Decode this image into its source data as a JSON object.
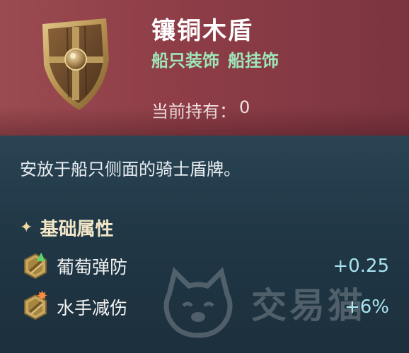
{
  "item": {
    "name": "镶铜木盾",
    "tags": [
      "船只装饰",
      "船挂饰"
    ],
    "owned_label": "当前持有：",
    "owned_count": "0",
    "description": "安放于船只侧面的骑士盾牌。"
  },
  "attributes": {
    "title": "基础属性",
    "stats": [
      {
        "name": "葡萄弹防",
        "value": "+0.25",
        "badge": "up-arrow-icon"
      },
      {
        "name": "水手减伤",
        "value": "+6%",
        "badge": "burst-icon"
      }
    ]
  },
  "watermark": {
    "text": "交易猫"
  },
  "colors": {
    "header_bg": "#8e3d47",
    "body_bg": "#213847",
    "tag_green": "#9ee6b8",
    "stat_value": "#a9e4f2",
    "title_gold": "#f3e7c8"
  }
}
